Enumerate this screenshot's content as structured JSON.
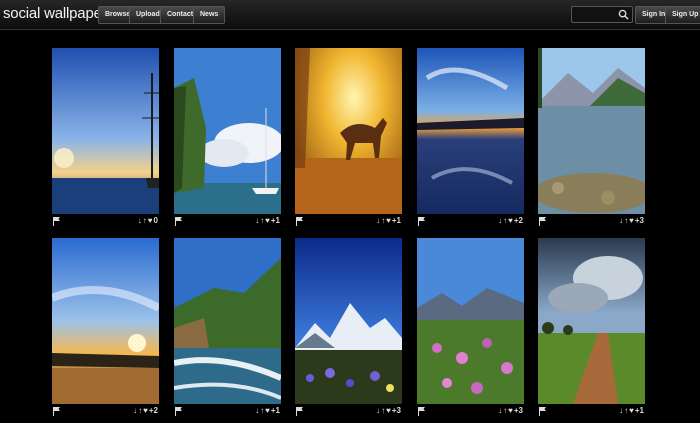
{
  "header": {
    "logo": "social wallpapering",
    "nav": [
      "Browse",
      "Upload",
      "Contact",
      "News"
    ],
    "search_placeholder": "",
    "sign_in": "Sign In",
    "sign_up": "Sign Up"
  },
  "icons": {
    "flag": "flag-icon",
    "down": "↓",
    "up": "↑",
    "heart": "♥",
    "search": "search-icon"
  },
  "wallpapers": [
    {
      "votes": "0"
    },
    {
      "votes": "+1"
    },
    {
      "votes": "+1"
    },
    {
      "votes": "+2"
    },
    {
      "votes": "+3"
    },
    {
      "votes": "+2"
    },
    {
      "votes": "+1"
    },
    {
      "votes": "+3"
    },
    {
      "votes": "+3"
    },
    {
      "votes": "+1"
    }
  ]
}
